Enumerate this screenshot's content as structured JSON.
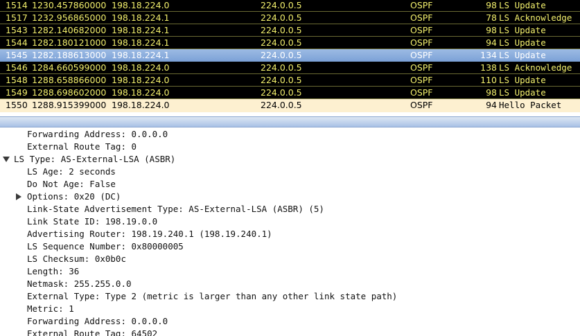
{
  "packets": [
    {
      "no": "1514",
      "time": "1230.457860000",
      "source": "198.18.224.0",
      "destination": "224.0.0.5",
      "protocol": "OSPF",
      "length": "98",
      "info": "LS Update",
      "style": "dark"
    },
    {
      "no": "1517",
      "time": "1232.956865000",
      "source": "198.18.224.1",
      "destination": "224.0.0.5",
      "protocol": "OSPF",
      "length": "78",
      "info": "LS Acknowledge",
      "style": "dark"
    },
    {
      "no": "1543",
      "time": "1282.140682000",
      "source": "198.18.224.1",
      "destination": "224.0.0.5",
      "protocol": "OSPF",
      "length": "98",
      "info": "LS Update",
      "style": "dark"
    },
    {
      "no": "1544",
      "time": "1282.180121000",
      "source": "198.18.224.1",
      "destination": "224.0.0.5",
      "protocol": "OSPF",
      "length": "94",
      "info": "LS Update",
      "style": "dark"
    },
    {
      "no": "1545",
      "time": "1282.188613000",
      "source": "198.18.224.1",
      "destination": "224.0.0.5",
      "protocol": "OSPF",
      "length": "134",
      "info": "LS Update",
      "style": "selected"
    },
    {
      "no": "1546",
      "time": "1284.660599000",
      "source": "198.18.224.0",
      "destination": "224.0.0.5",
      "protocol": "OSPF",
      "length": "138",
      "info": "LS Acknowledge",
      "style": "dark"
    },
    {
      "no": "1548",
      "time": "1288.658866000",
      "source": "198.18.224.0",
      "destination": "224.0.0.5",
      "protocol": "OSPF",
      "length": "110",
      "info": "LS Update",
      "style": "dark"
    },
    {
      "no": "1549",
      "time": "1288.698602000",
      "source": "198.18.224.0",
      "destination": "224.0.0.5",
      "protocol": "OSPF",
      "length": "98",
      "info": "LS Update",
      "style": "dark"
    },
    {
      "no": "1550",
      "time": "1288.915399000",
      "source": "198.18.224.0",
      "destination": "224.0.0.5",
      "protocol": "OSPF",
      "length": "94",
      "info": "Hello Packet",
      "style": "hello"
    }
  ],
  "details": [
    {
      "text": "Forwarding Address: 0.0.0.0",
      "level": 2
    },
    {
      "text": "External Route Tag: 0",
      "level": 2
    },
    {
      "text": "LS Type: AS-External-LSA (ASBR)",
      "level": 1,
      "expander": "expanded"
    },
    {
      "text": "LS Age: 2 seconds",
      "level": 2
    },
    {
      "text": "Do Not Age: False",
      "level": 2
    },
    {
      "text": "Options: 0x20 (DC)",
      "level": 2,
      "expander": "collapsed"
    },
    {
      "text": "Link-State Advertisement Type: AS-External-LSA (ASBR) (5)",
      "level": 2
    },
    {
      "text": "Link State ID: 198.19.0.0",
      "level": 2
    },
    {
      "text": "Advertising Router: 198.19.240.1 (198.19.240.1)",
      "level": 2
    },
    {
      "text": "LS Sequence Number: 0x80000005",
      "level": 2
    },
    {
      "text": "LS Checksum: 0x0b0c",
      "level": 2
    },
    {
      "text": "Length: 36",
      "level": 2
    },
    {
      "text": "Netmask: 255.255.0.0",
      "level": 2
    },
    {
      "text": "External Type: Type 2 (metric is larger than any other link state path)",
      "level": 2
    },
    {
      "text": "Metric: 1",
      "level": 2
    },
    {
      "text": "Forwarding Address: 0.0.0.0",
      "level": 2
    },
    {
      "text": "External Route Tag: 64502",
      "level": 2
    }
  ],
  "colors": {
    "row_dark_bg": "#000000",
    "row_dark_fg": "#f2ef6c",
    "row_selected_bg": "#8aaee0",
    "row_hello_bg": "#fdf0d0"
  }
}
